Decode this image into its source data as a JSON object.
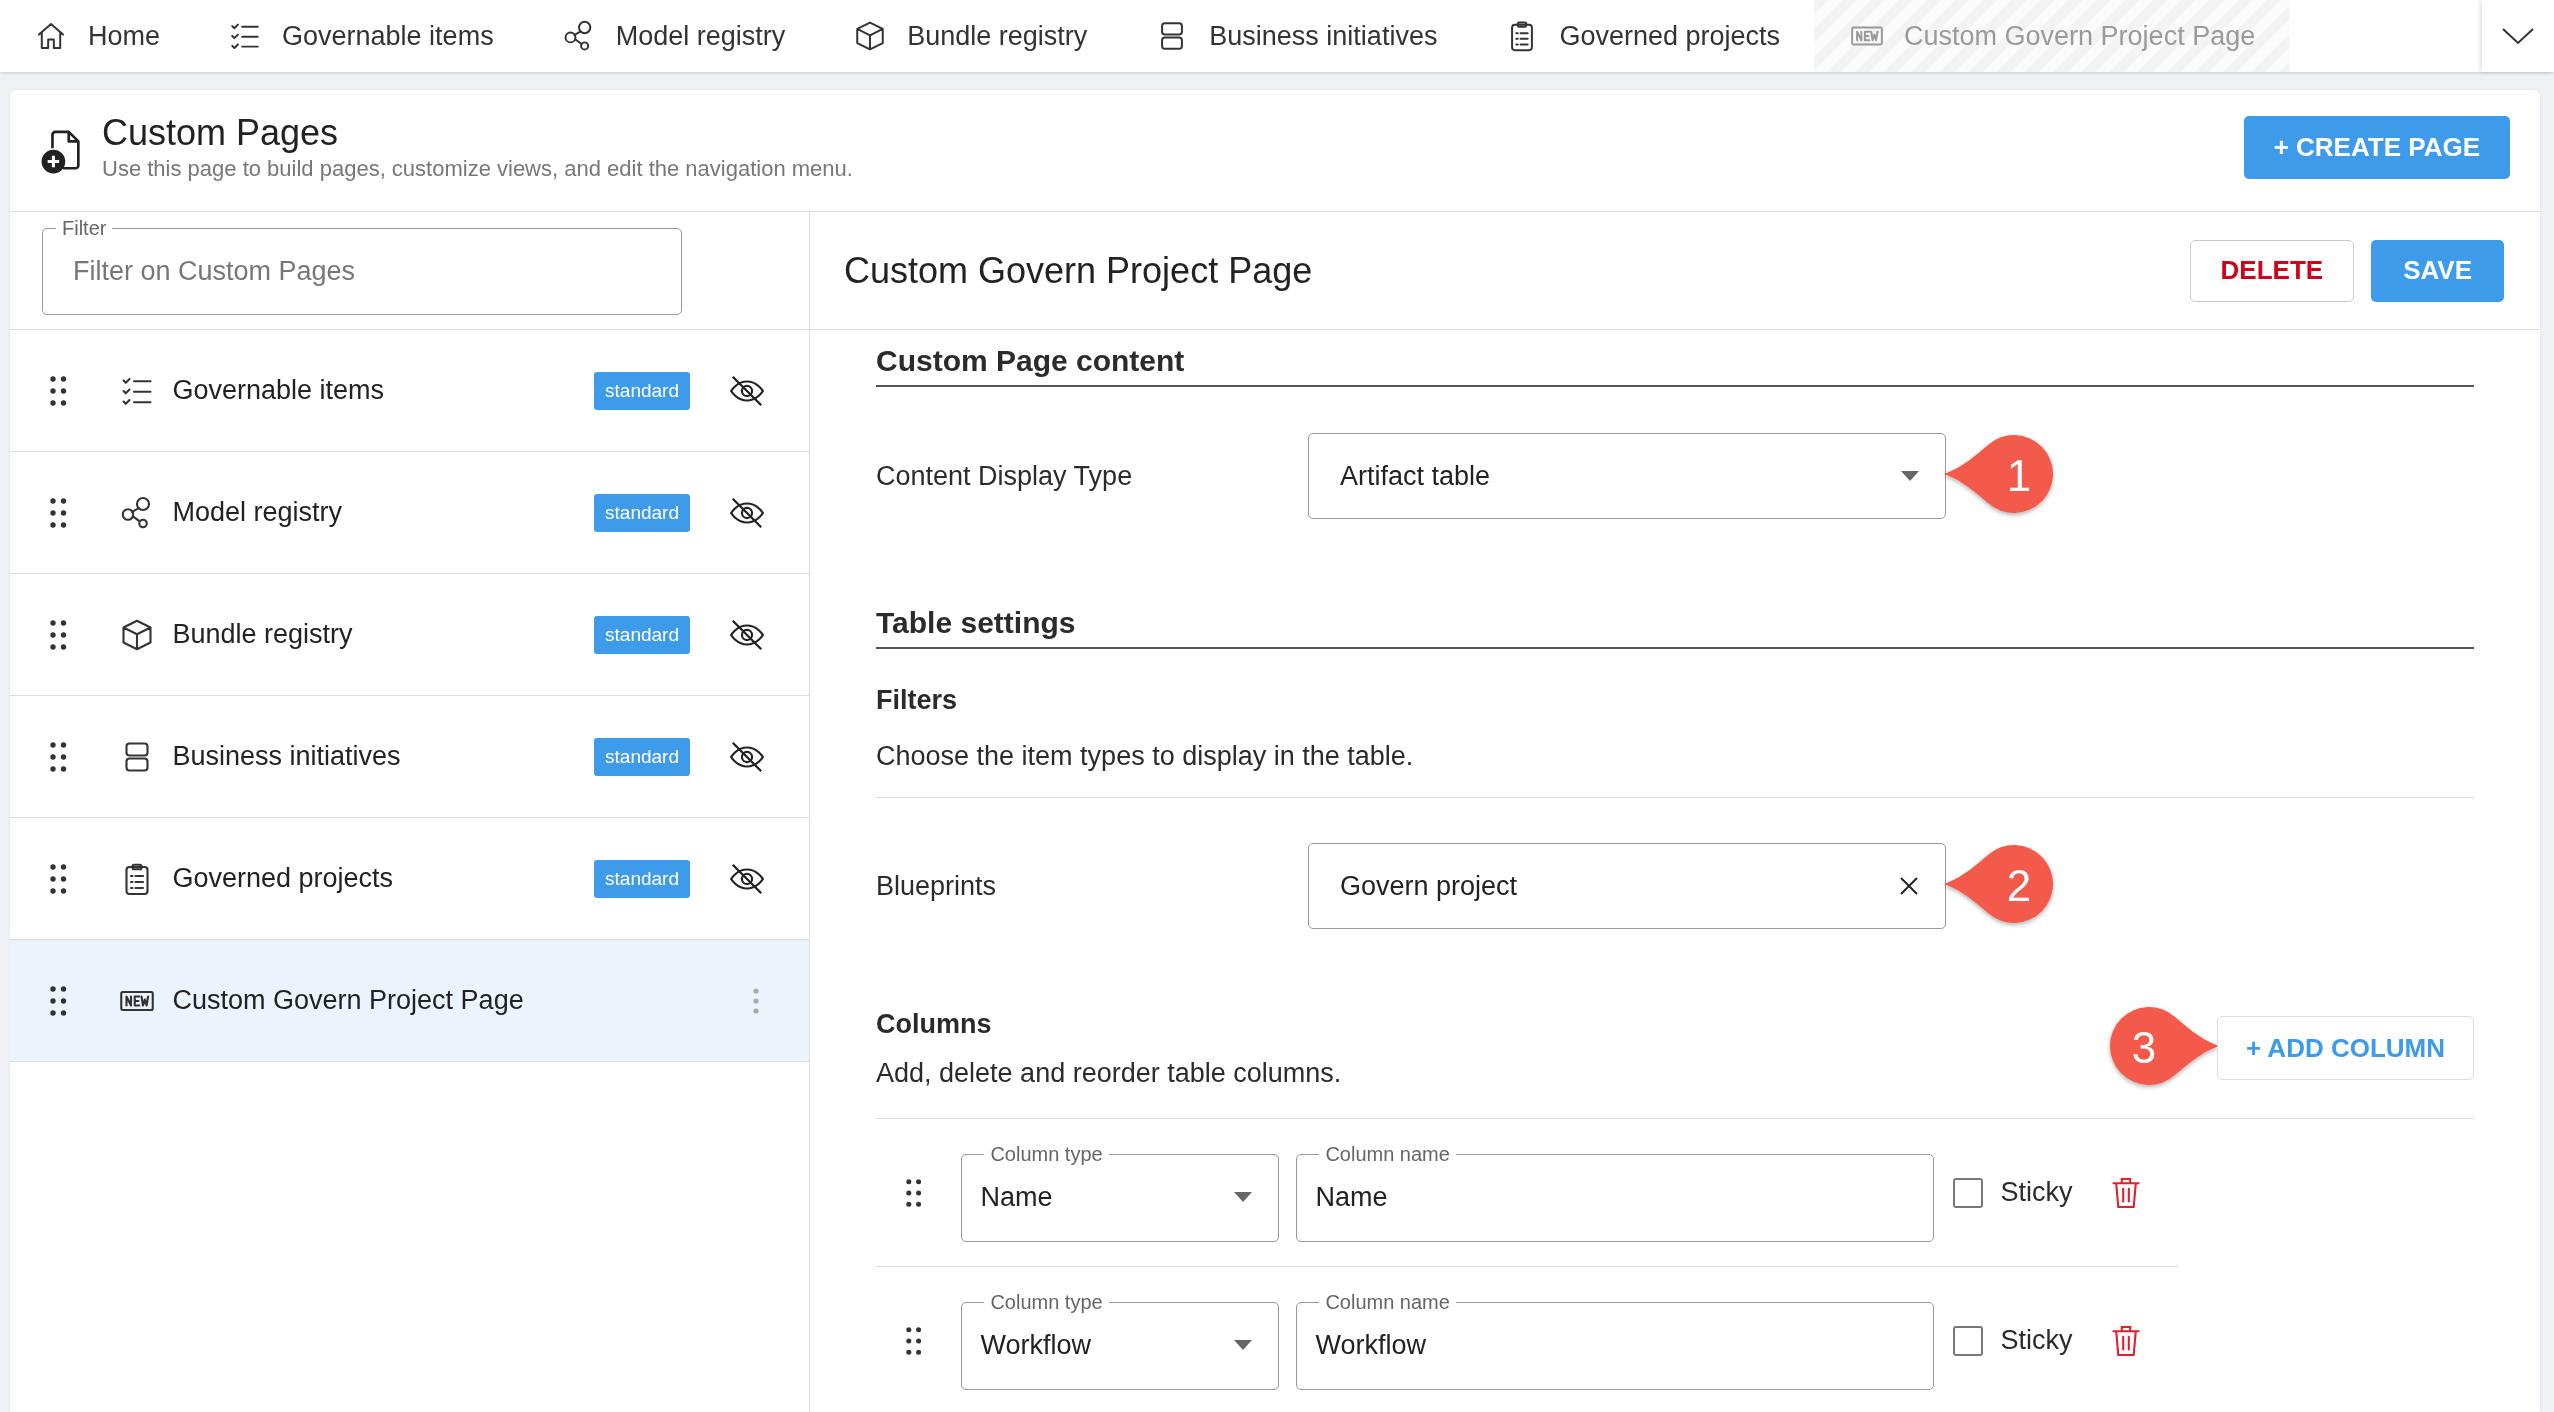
{
  "nav_tabs": [
    {
      "label": "Home",
      "selected": false
    },
    {
      "label": "Governable items",
      "selected": false
    },
    {
      "label": "Model registry",
      "selected": false
    },
    {
      "label": "Bundle registry",
      "selected": false
    },
    {
      "label": "Business initiatives",
      "selected": false
    },
    {
      "label": "Governed projects",
      "selected": false
    },
    {
      "label": "Custom Govern Project Page",
      "selected": true
    }
  ],
  "page_header": {
    "title": "Custom Pages",
    "subtitle": "Use this page to build pages, customize views, and edit the navigation menu.",
    "create_button": "+ CREATE PAGE"
  },
  "filter": {
    "label": "Filter",
    "placeholder": "Filter on Custom Pages"
  },
  "pages": [
    {
      "label": "Governable items",
      "kind": "standard",
      "badge": "standard",
      "visible": false,
      "selected": false
    },
    {
      "label": "Model registry",
      "kind": "standard",
      "badge": "standard",
      "visible": false,
      "selected": false
    },
    {
      "label": "Bundle registry",
      "kind": "standard",
      "badge": "standard",
      "visible": false,
      "selected": false
    },
    {
      "label": "Business initiatives",
      "kind": "standard",
      "badge": "standard",
      "visible": false,
      "selected": false
    },
    {
      "label": "Governed projects",
      "kind": "standard",
      "badge": "standard",
      "visible": false,
      "selected": false
    },
    {
      "label": "Custom Govern Project Page",
      "kind": "custom",
      "selected": true
    }
  ],
  "editor": {
    "title": "Custom Govern Project Page",
    "delete_button": "DELETE",
    "save_button": "SAVE",
    "content_section": {
      "heading": "Custom Page content",
      "content_display_type": {
        "label": "Content Display Type",
        "value": "Artifact table",
        "callout": "1"
      }
    },
    "table_settings": {
      "heading": "Table settings",
      "filters": {
        "heading": "Filters",
        "description": "Choose the item types to display in the table."
      },
      "blueprints": {
        "label": "Blueprints",
        "value": "Govern project",
        "callout": "2"
      },
      "columns": {
        "heading": "Columns",
        "description": "Add, delete and reorder table columns.",
        "add_button": "+ ADD COLUMN",
        "callout": "3",
        "rows": [
          {
            "type_label": "Column type",
            "type": "Name",
            "name_label": "Column name",
            "name": "Name",
            "sticky_label": "Sticky",
            "sticky": false
          },
          {
            "type_label": "Column type",
            "type": "Workflow",
            "name_label": "Column name",
            "name": "Workflow",
            "sticky_label": "Sticky",
            "sticky": false
          }
        ]
      }
    }
  }
}
